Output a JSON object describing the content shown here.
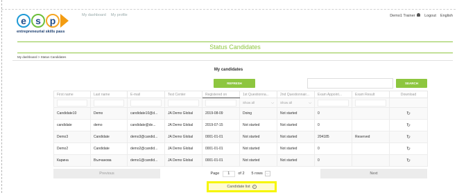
{
  "logo": {
    "letters": [
      "e",
      "s",
      "p"
    ],
    "tagline": "entrepreneurial skills pass"
  },
  "topnav": {
    "dashboard": "My dashboard",
    "profile": "My profile"
  },
  "usernav": {
    "user": "Demo1 Trainer",
    "logout": "Logout",
    "language": "English",
    "user_icon": "user-icon"
  },
  "page_title": "Status Candidates",
  "breadcrumb": "My dashboard  >  Status Candidates",
  "section_title": "My candidates",
  "buttons": {
    "refresh": "REFRESH",
    "search": "SEARCH"
  },
  "search": {
    "value": "",
    "placeholder": ""
  },
  "table": {
    "headers": [
      "First name",
      "Last name",
      "E-mail",
      "Test Center",
      "Registered on",
      "1st Questionna...",
      "2nd Questionnair...",
      "Exam Appoint...",
      "Exam Result",
      "Download"
    ],
    "filter_select": "Show all",
    "rows": [
      [
        "Candidate10",
        "Demo",
        "candidate10@d...",
        "JA Demo Global",
        "2019-08-09",
        "Doing",
        "Not started",
        "0",
        "",
        "↻"
      ],
      [
        "candidate",
        "demo",
        "candidate@de...",
        "JA Demo Global",
        "2019-07-15",
        "Not started",
        "Not started",
        "0",
        "",
        "↻"
      ],
      [
        "Demo3",
        "Candidate",
        "demo3@candid...",
        "JA Demo Global",
        "0001-01-01",
        "Not started",
        "Not started",
        "204185",
        "Reserved",
        "↻"
      ],
      [
        "Demo2",
        "Candidate",
        "demo2@candid...",
        "JA Demo Global",
        "0001-01-01",
        "Not started",
        "Not started",
        "0",
        "",
        "↻"
      ],
      [
        "Карина",
        "Вълчанова",
        "demo1@candid...",
        "JA Demo Global",
        "0001-01-01",
        "Not started",
        "Not started",
        "0",
        "",
        "↻"
      ]
    ]
  },
  "pager": {
    "previous": "Previous",
    "page_label": "Page",
    "page_value": "1",
    "of_label": "of 2",
    "rows_label": "5 rows",
    "next": "Next"
  },
  "candidate_list": {
    "label": "Candidate list",
    "icon": "info-icon"
  },
  "colors": {
    "accent": "#8dc63f",
    "highlight": "#f6f600"
  }
}
